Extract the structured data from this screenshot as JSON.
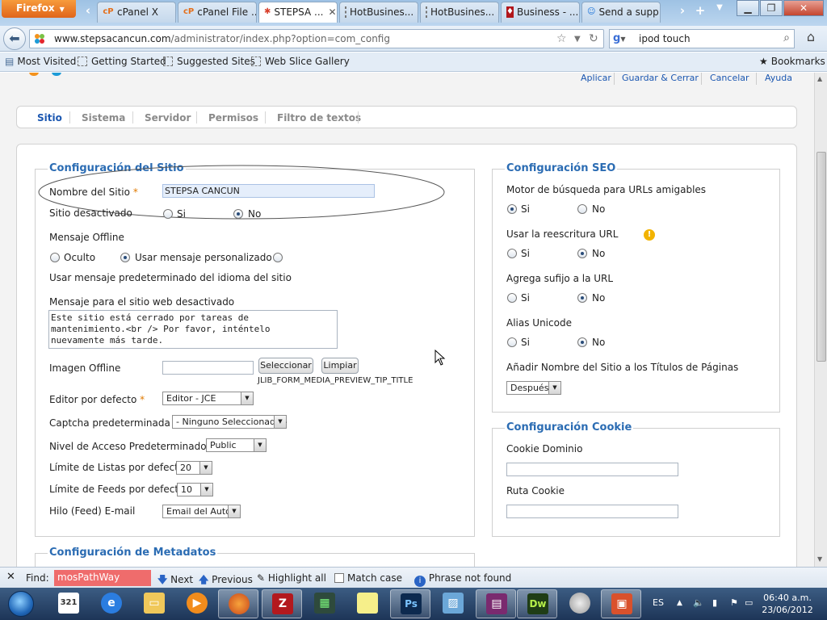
{
  "browser": {
    "menu_label": "Firefox",
    "tabs": [
      {
        "label": "cPanel X",
        "icon": "cpanel-icon"
      },
      {
        "label": "cPanel File ...",
        "icon": "cpanel-icon"
      },
      {
        "label": "STEPSA ...",
        "icon": "joomla-icon"
      },
      {
        "label": "HotBusines...",
        "icon": "page-icon"
      },
      {
        "label": "HotBusines...",
        "icon": "page-icon"
      },
      {
        "label": "Business - ...",
        "icon": "business-icon"
      },
      {
        "label": "Send a supp...",
        "icon": "support-icon"
      }
    ],
    "url_host": "www.stepsacancun.com",
    "url_path": "/administrator/index.php?option=com_config",
    "search_value": "ipod touch",
    "bookmarks": [
      "Most Visited",
      "Getting Started",
      "Suggested Sites",
      "Web Slice Gallery"
    ],
    "bookmarks_menu": "Bookmarks"
  },
  "toolbar": {
    "apply": "Aplicar",
    "save_close": "Guardar & Cerrar",
    "cancel": "Cancelar",
    "help": "Ayuda"
  },
  "subtabs": [
    "Sitio",
    "Sistema",
    "Servidor",
    "Permisos",
    "Filtro de textos"
  ],
  "site": {
    "legend": "Configuración del Sitio",
    "site_name_label": "Nombre del Sitio",
    "site_name_value": "STEPSA CANCUN",
    "offline_label": "Sitio desactivado",
    "yes": "Si",
    "no": "No",
    "offline_msg_label": "Mensaje Offline",
    "opt_hidden": "Oculto",
    "opt_custom": "Usar mensaje personalizado",
    "opt_default": "Usar mensaje predeterminado del idioma del sitio",
    "offline_text_label": "Mensaje para el sitio web desactivado",
    "offline_text_value": "Este sitio está cerrado por tareas de\nmantenimiento.<br /> Por favor, inténtelo\nnuevamente más tarde.",
    "offline_image_label": "Imagen Offline",
    "select_btn": "Seleccionar",
    "clear_btn": "Limpiar",
    "media_tip": "JLIB_FORM_MEDIA_PREVIEW_TIP_TITLE",
    "editor_label": "Editor por defecto",
    "editor_value": "Editor - JCE",
    "captcha_label": "Captcha predeterminada",
    "captcha_value": "- Ninguno Seleccionado -",
    "access_label": "Nivel de Acceso Predeterminado",
    "access_value": "Public",
    "list_limit_label": "Límite de Listas por defecto",
    "list_limit_value": "20",
    "feed_limit_label": "Límite de Feeds por defecto",
    "feed_limit_value": "10",
    "feed_email_label": "Hilo (Feed) E-mail",
    "feed_email_value": "Email del Autor",
    "meta_legend": "Configuración de Metadatos"
  },
  "seo": {
    "legend": "Configuración SEO",
    "sef_label": "Motor de búsqueda para URLs amigables",
    "rewrite_label": "Usar la reescritura URL",
    "suffix_label": "Agrega sufijo a la URL",
    "unicode_label": "Alias Unicode",
    "sitename_titles_label": "Añadir Nombre del Sitio a los Títulos de Páginas",
    "sitename_titles_value": "Después",
    "yes": "Si",
    "no": "No"
  },
  "cookie": {
    "legend": "Configuración Cookie",
    "domain_label": "Cookie Dominio",
    "path_label": "Ruta Cookie"
  },
  "findbar": {
    "find_label": "Find:",
    "query": "mosPathWay",
    "next": "Next",
    "previous": "Previous",
    "highlight": "Highlight all",
    "match_case": "Match case",
    "status": "Phrase not found"
  },
  "taskbar": {
    "lang": "ES",
    "time": "06:40 a.m.",
    "date": "23/06/2012",
    "calendar_day": "321"
  }
}
